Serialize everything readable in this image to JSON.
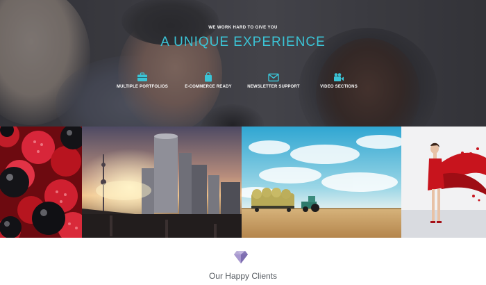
{
  "hero": {
    "subtitle": "WE WORK HARD TO GIVE YOU",
    "title": "A UNIQUE EXPERIENCE",
    "accent_color": "#3bc4d6",
    "features": [
      {
        "icon": "briefcase-icon",
        "label": "MULTIPLE PORTFOLIOS"
      },
      {
        "icon": "shopping-bag-icon",
        "label": "E-COMMERCE READY"
      },
      {
        "icon": "envelope-icon",
        "label": "NEWSLETTER SUPPORT"
      },
      {
        "icon": "video-camera-icon",
        "label": "VIDEO SECTIONS"
      }
    ]
  },
  "portfolio": {
    "items": [
      {
        "subject": "berries"
      },
      {
        "subject": "city skyline"
      },
      {
        "subject": "hay field with tractor"
      },
      {
        "subject": "woman in red paint"
      }
    ]
  },
  "clients": {
    "icon": "diamond-icon",
    "title": "Our Happy Clients"
  }
}
